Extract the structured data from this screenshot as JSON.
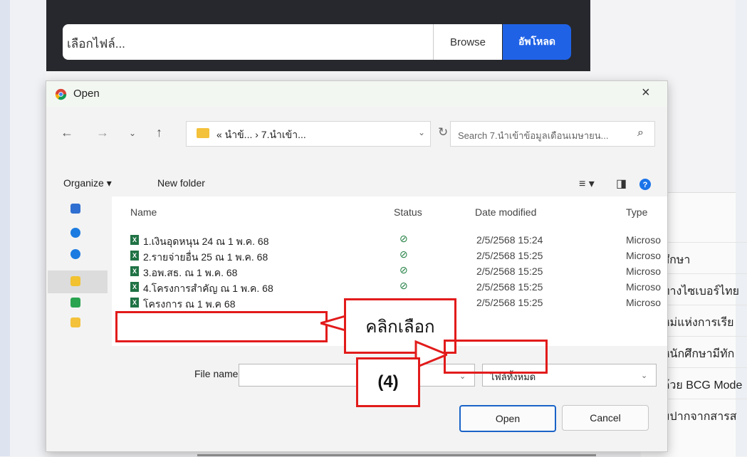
{
  "upload": {
    "placeholder": "เลือกไฟล์...",
    "browse_label": "Browse",
    "upload_label": "อัพโหลด"
  },
  "background_page": {
    "rows": [
      "ศึกษา",
      "ทางไซเบอร์ไทย",
      "หม่แห่งการเรีย",
      "หนักศึกษามีทัก",
      "ด้วย BCG Mode",
      "มปากจากสารส"
    ]
  },
  "dialog": {
    "title": "Open",
    "close_label": "×",
    "breadcrumb": "« นำข้... › 7.นำเข้า...",
    "search_placeholder": "Search 7.นำเข้าข้อมูลเดือนเมษายน...",
    "organize_label": "Organize ▾",
    "new_folder_label": "New folder",
    "columns": {
      "name": "Name",
      "status": "Status",
      "date": "Date modified",
      "type": "Type"
    },
    "files": [
      {
        "name": "1.เงินอุดหนุน 24 ณ 1 พ.ค. 68",
        "date": "2/5/2568 15:24",
        "type": "Microso"
      },
      {
        "name": "2.รายจ่ายอื่น 25 ณ 1 พ.ค. 68",
        "date": "2/5/2568 15:25",
        "type": "Microso"
      },
      {
        "name": "3.อพ.สธ. ณ 1 พ.ค. 68",
        "date": "2/5/2568 15:25",
        "type": "Microso"
      },
      {
        "name": "4.โครงการสำคัญ ณ 1 พ.ค. 68",
        "date": "2/5/2568 15:25",
        "type": "Microso"
      },
      {
        "name": "โครงการ ณ 1 พ.ค 68",
        "date": "2/5/2568 15:25",
        "type": "Microso"
      }
    ],
    "file_name_label": "File name:",
    "file_name_value": "",
    "filter_value": "ไฟล์ทั้งหมด",
    "open_label": "Open",
    "cancel_label": "Cancel"
  },
  "annotations": {
    "select_callout": "คลิกเลือก",
    "step_label": "(4)"
  }
}
